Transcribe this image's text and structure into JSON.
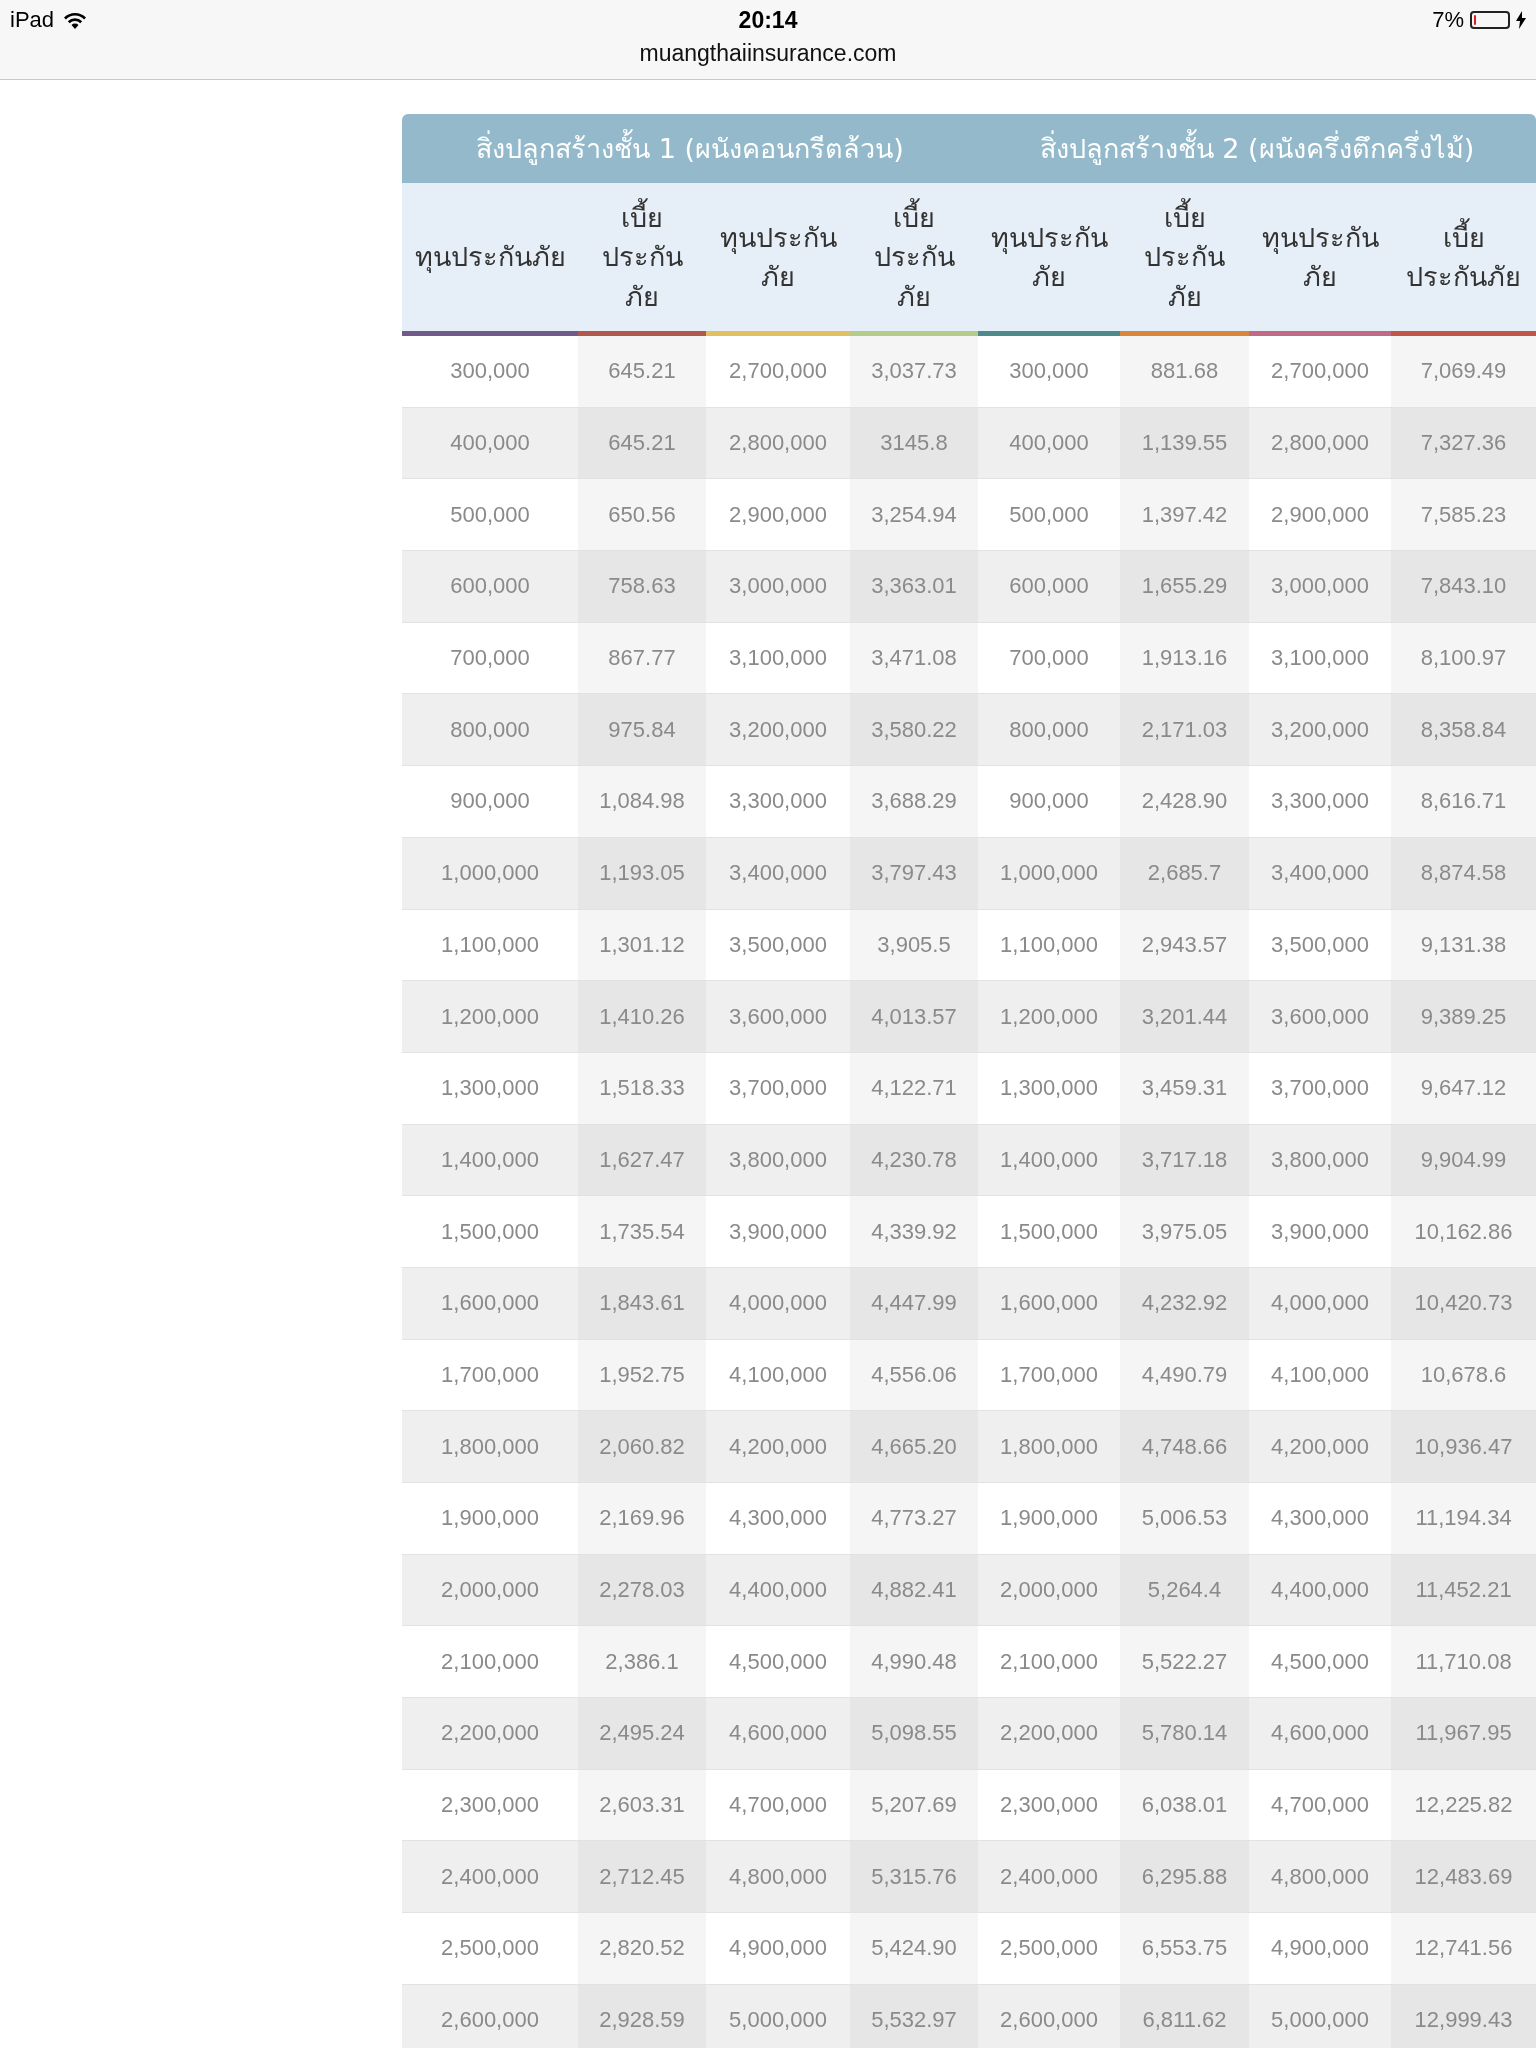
{
  "status_bar": {
    "device": "iPad",
    "time": "20:14",
    "battery_text": "7%",
    "battery": {
      "level": 0.07
    }
  },
  "address_bar": {
    "url": "muangthaiinsurance.com"
  },
  "table": {
    "groups": [
      "สิ่งปลูกสร้างชั้น 1 (ผนังคอนกรีตล้วน)",
      "สิ่งปลูกสร้างชั้น 2 (ผนังครึ่งตึกครึ่งไม้)"
    ],
    "columns": [
      {
        "label": "ทุนประกันภัย",
        "color": "#6f5a8a"
      },
      {
        "label": "เบี้ยประกันภัย",
        "color": "#b0584e"
      },
      {
        "label": "ทุนประกันภัย",
        "color": "#e0c060"
      },
      {
        "label": "เบี้ยประกันภัย",
        "color": "#b3cc8a"
      },
      {
        "label": "ทุนประกันภัย",
        "color": "#4f8a8a"
      },
      {
        "label": "เบี้ยประกันภัย",
        "color": "#d9853b"
      },
      {
        "label": "ทุนประกันภัย",
        "color": "#c06a86"
      },
      {
        "label": "เบี้ยประกันภัย",
        "color": "#c0564a"
      }
    ],
    "rows": [
      [
        "300,000",
        "645.21",
        "2,700,000",
        "3,037.73",
        "300,000",
        "881.68",
        "2,700,000",
        "7,069.49"
      ],
      [
        "400,000",
        "645.21",
        "2,800,000",
        "3145.8",
        "400,000",
        "1,139.55",
        "2,800,000",
        "7,327.36"
      ],
      [
        "500,000",
        "650.56",
        "2,900,000",
        "3,254.94",
        "500,000",
        "1,397.42",
        "2,900,000",
        "7,585.23"
      ],
      [
        "600,000",
        "758.63",
        "3,000,000",
        "3,363.01",
        "600,000",
        "1,655.29",
        "3,000,000",
        "7,843.10"
      ],
      [
        "700,000",
        "867.77",
        "3,100,000",
        "3,471.08",
        "700,000",
        "1,913.16",
        "3,100,000",
        "8,100.97"
      ],
      [
        "800,000",
        "975.84",
        "3,200,000",
        "3,580.22",
        "800,000",
        "2,171.03",
        "3,200,000",
        "8,358.84"
      ],
      [
        "900,000",
        "1,084.98",
        "3,300,000",
        "3,688.29",
        "900,000",
        "2,428.90",
        "3,300,000",
        "8,616.71"
      ],
      [
        "1,000,000",
        "1,193.05",
        "3,400,000",
        "3,797.43",
        "1,000,000",
        "2,685.7",
        "3,400,000",
        "8,874.58"
      ],
      [
        "1,100,000",
        "1,301.12",
        "3,500,000",
        "3,905.5",
        "1,100,000",
        "2,943.57",
        "3,500,000",
        "9,131.38"
      ],
      [
        "1,200,000",
        "1,410.26",
        "3,600,000",
        "4,013.57",
        "1,200,000",
        "3,201.44",
        "3,600,000",
        "9,389.25"
      ],
      [
        "1,300,000",
        "1,518.33",
        "3,700,000",
        "4,122.71",
        "1,300,000",
        "3,459.31",
        "3,700,000",
        "9,647.12"
      ],
      [
        "1,400,000",
        "1,627.47",
        "3,800,000",
        "4,230.78",
        "1,400,000",
        "3,717.18",
        "3,800,000",
        "9,904.99"
      ],
      [
        "1,500,000",
        "1,735.54",
        "3,900,000",
        "4,339.92",
        "1,500,000",
        "3,975.05",
        "3,900,000",
        "10,162.86"
      ],
      [
        "1,600,000",
        "1,843.61",
        "4,000,000",
        "4,447.99",
        "1,600,000",
        "4,232.92",
        "4,000,000",
        "10,420.73"
      ],
      [
        "1,700,000",
        "1,952.75",
        "4,100,000",
        "4,556.06",
        "1,700,000",
        "4,490.79",
        "4,100,000",
        "10,678.6"
      ],
      [
        "1,800,000",
        "2,060.82",
        "4,200,000",
        "4,665.20",
        "1,800,000",
        "4,748.66",
        "4,200,000",
        "10,936.47"
      ],
      [
        "1,900,000",
        "2,169.96",
        "4,300,000",
        "4,773.27",
        "1,900,000",
        "5,006.53",
        "4,300,000",
        "11,194.34"
      ],
      [
        "2,000,000",
        "2,278.03",
        "4,400,000",
        "4,882.41",
        "2,000,000",
        "5,264.4",
        "4,400,000",
        "11,452.21"
      ],
      [
        "2,100,000",
        "2,386.1",
        "4,500,000",
        "4,990.48",
        "2,100,000",
        "5,522.27",
        "4,500,000",
        "11,710.08"
      ],
      [
        "2,200,000",
        "2,495.24",
        "4,600,000",
        "5,098.55",
        "2,200,000",
        "5,780.14",
        "4,600,000",
        "11,967.95"
      ],
      [
        "2,300,000",
        "2,603.31",
        "4,700,000",
        "5,207.69",
        "2,300,000",
        "6,038.01",
        "4,700,000",
        "12,225.82"
      ],
      [
        "2,400,000",
        "2,712.45",
        "4,800,000",
        "5,315.76",
        "2,400,000",
        "6,295.88",
        "4,800,000",
        "12,483.69"
      ],
      [
        "2,500,000",
        "2,820.52",
        "4,900,000",
        "5,424.90",
        "2,500,000",
        "6,553.75",
        "4,900,000",
        "12,741.56"
      ],
      [
        "2,600,000",
        "2,928.59",
        "5,000,000",
        "5,532.97",
        "2,600,000",
        "6,811.62",
        "5,000,000",
        "12,999.43"
      ]
    ]
  }
}
